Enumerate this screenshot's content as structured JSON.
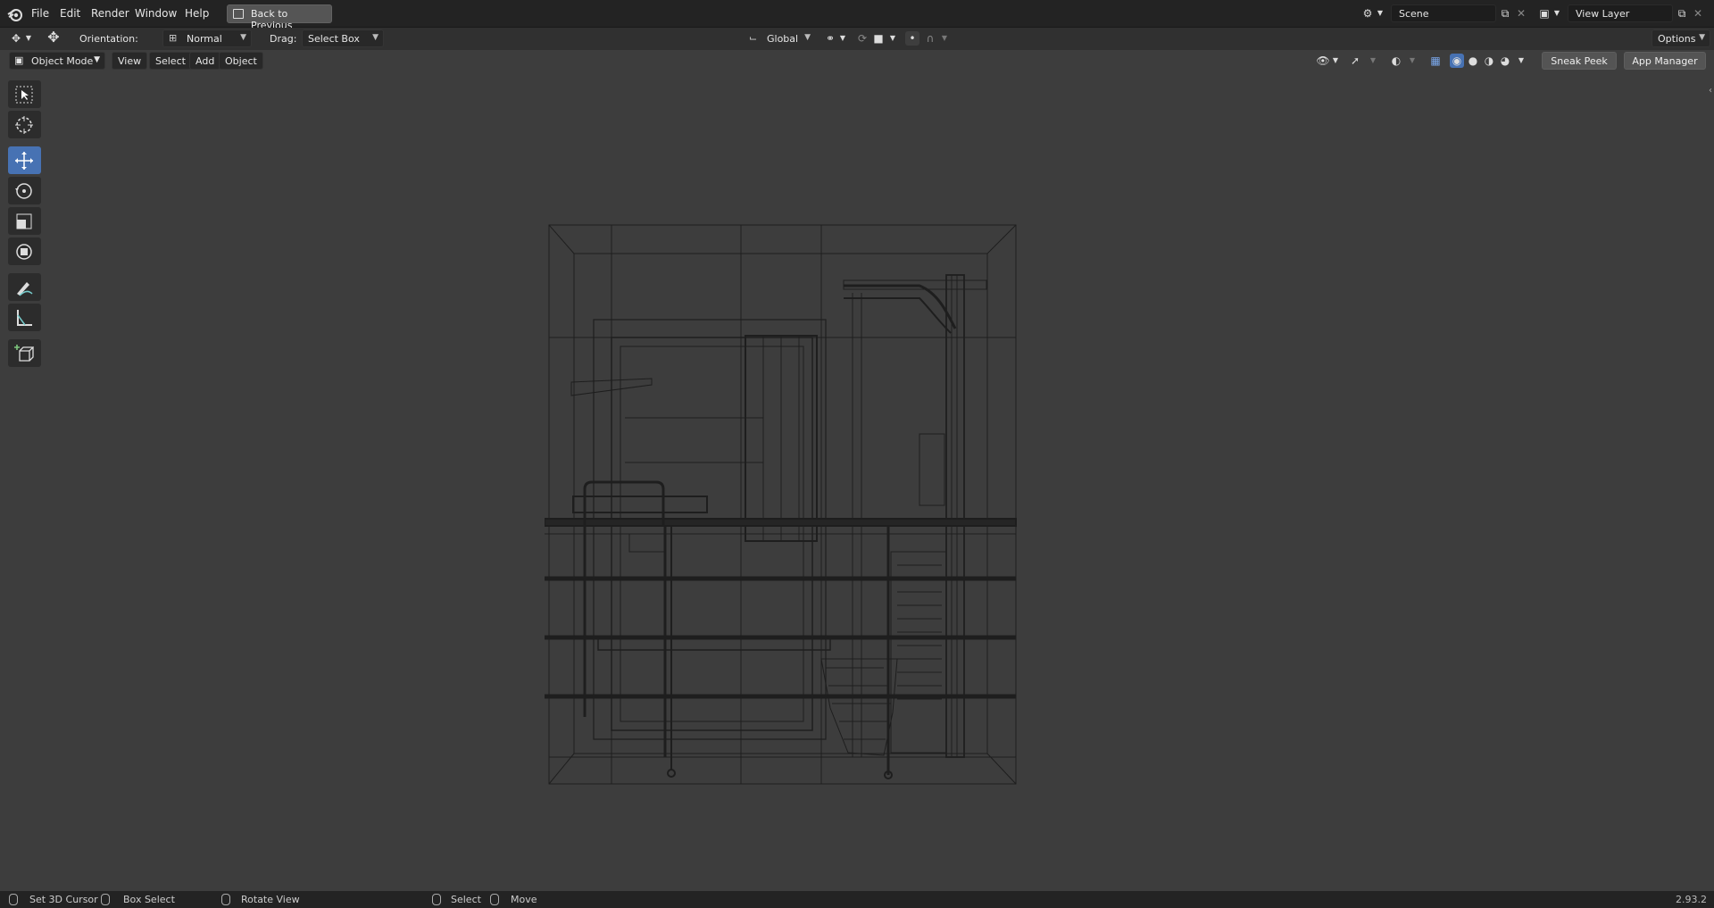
{
  "menubar": {
    "items": [
      "File",
      "Edit",
      "Render",
      "Window",
      "Help"
    ],
    "back_button": "Back to Previous",
    "scene_name": "Scene",
    "view_layer_name": "View Layer"
  },
  "tool_header": {
    "orientation_label": "Orientation:",
    "orientation_value": "Normal",
    "drag_label": "Drag:",
    "drag_value": "Select Box",
    "transform_orientation": "Global",
    "options_label": "Options"
  },
  "viewport_header": {
    "mode": "Object Mode",
    "menus": [
      "View",
      "Select",
      "Add",
      "Object"
    ],
    "sneak_peek": "Sneak Peek",
    "app_manager": "App Manager"
  },
  "toolbar": {
    "tools": [
      "select-box",
      "cursor",
      "move",
      "rotate",
      "scale",
      "transform",
      "annotate",
      "measure",
      "add-cube"
    ],
    "active_tool": "move"
  },
  "statusbar": {
    "items": [
      "Set 3D Cursor",
      "Box Select",
      "Rotate View",
      "Select",
      "Move"
    ],
    "version": "2.93.2"
  },
  "colors": {
    "active_tool": "#4772b3",
    "viewport_bg": "#3d3d3d",
    "topbar_bg": "#232323"
  }
}
